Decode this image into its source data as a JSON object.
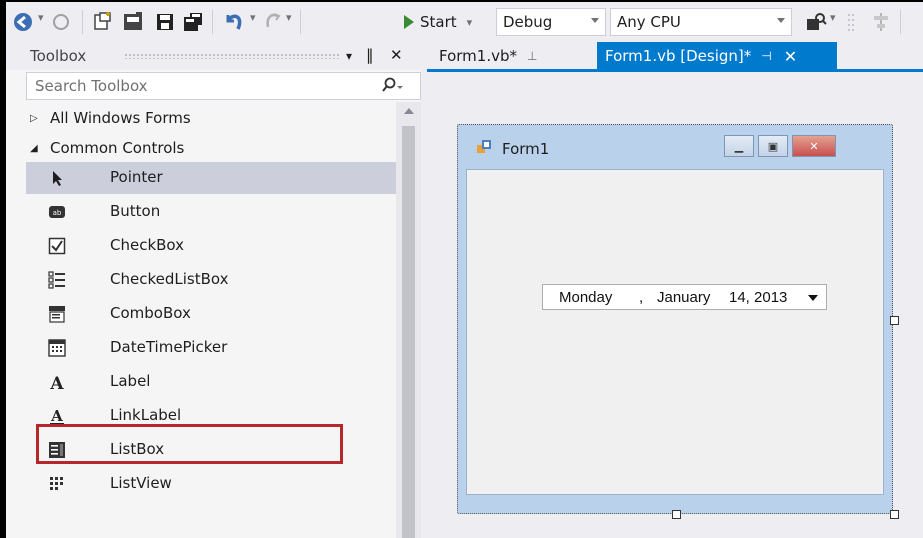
{
  "toolbar": {
    "start_label": "Start",
    "config_value": "Debug",
    "platform_value": "Any CPU"
  },
  "toolbox": {
    "title": "Toolbox",
    "pin_glyph": "‖",
    "dropdown_glyph": "▾",
    "close_glyph": "✕",
    "search_placeholder": "Search Toolbox",
    "groups": [
      {
        "label": "All Windows Forms",
        "expanded": false
      },
      {
        "label": "Common Controls",
        "expanded": true
      }
    ],
    "items": [
      {
        "label": "Pointer",
        "icon": "pointer-icon",
        "selected": true
      },
      {
        "label": "Button",
        "icon": "button-icon"
      },
      {
        "label": "CheckBox",
        "icon": "checkbox-icon"
      },
      {
        "label": "CheckedListBox",
        "icon": "checkedlistbox-icon"
      },
      {
        "label": "ComboBox",
        "icon": "combobox-icon"
      },
      {
        "label": "DateTimePicker",
        "icon": "datetimepicker-icon",
        "highlighted": true
      },
      {
        "label": "Label",
        "icon": "label-icon"
      },
      {
        "label": "LinkLabel",
        "icon": "linklabel-icon"
      },
      {
        "label": "ListBox",
        "icon": "listbox-icon"
      },
      {
        "label": "ListView",
        "icon": "listview-icon"
      }
    ]
  },
  "tabs": [
    {
      "label": "Form1.vb*",
      "active": false
    },
    {
      "label": "Form1.vb [Design]*",
      "active": true
    }
  ],
  "form": {
    "title": "Form1",
    "datetimepicker": {
      "day": "Monday",
      "sep": ",",
      "month": "January",
      "date": "14, 2013"
    }
  },
  "colors": {
    "accent": "#007ACC",
    "highlight_box": "#B5272B",
    "selected_row": "#CCCEDB"
  }
}
